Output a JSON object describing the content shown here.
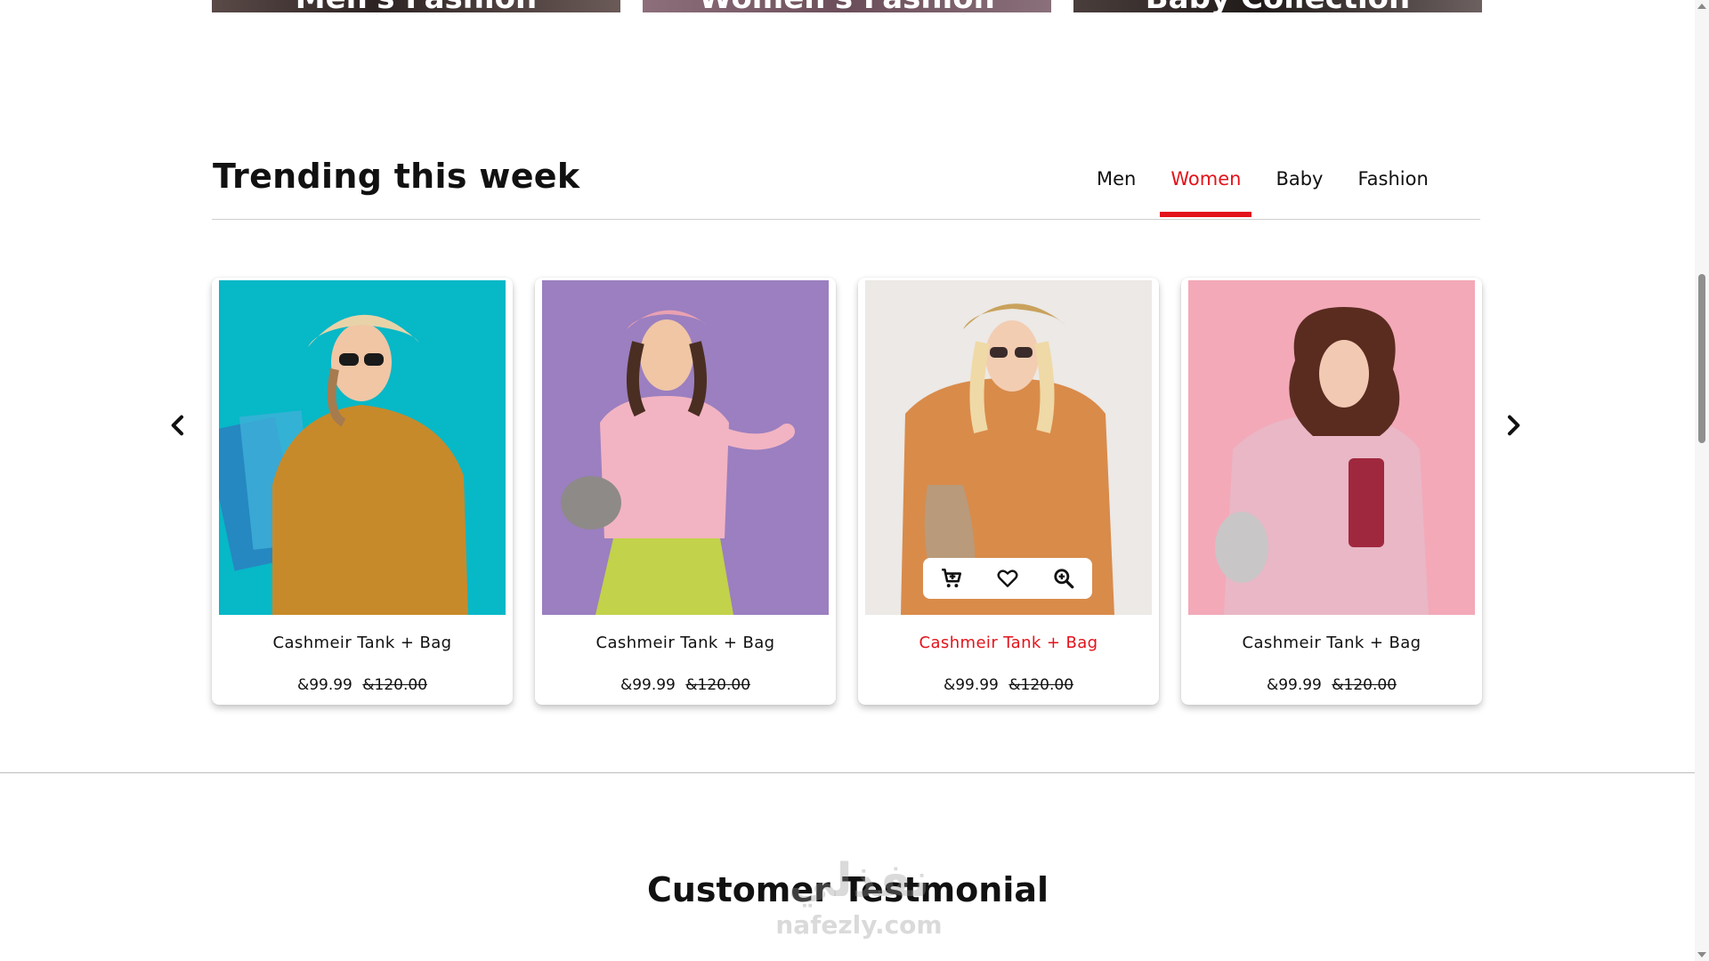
{
  "categories": [
    {
      "label": "Men's Fashion"
    },
    {
      "label": "Women's Fashion"
    },
    {
      "label": "Baby Collection"
    }
  ],
  "trending": {
    "title": "Trending this week",
    "tabs": [
      {
        "label": "Men"
      },
      {
        "label": "Women"
      },
      {
        "label": "Baby"
      },
      {
        "label": "Fashion"
      }
    ],
    "active_tab": "Women",
    "products": [
      {
        "name": "Cashmeir Tank + Bag",
        "price": "&99.99",
        "old_price": "&120.00",
        "image_bg": "#07b8c7"
      },
      {
        "name": "Cashmeir Tank + Bag",
        "price": "&99.99",
        "old_price": "&120.00",
        "image_bg": "#9b7fc0"
      },
      {
        "name": "Cashmeir Tank + Bag",
        "price": "&99.99",
        "old_price": "&120.00",
        "image_bg": "#ece9e6"
      },
      {
        "name": "Cashmeir Tank + Bag",
        "price": "&99.99",
        "old_price": "&120.00",
        "image_bg": "#f3a9b8"
      }
    ],
    "hover_actions": [
      "cart-add-icon",
      "heart-icon",
      "zoom-in-icon"
    ]
  },
  "testimonial": {
    "title": "Customer Testmonial"
  },
  "watermark": {
    "arabic": "نفذلي",
    "url": "nafezly.com"
  },
  "colors": {
    "accent": "#e3131b",
    "text": "#111111",
    "divider": "#cfcfcf"
  }
}
